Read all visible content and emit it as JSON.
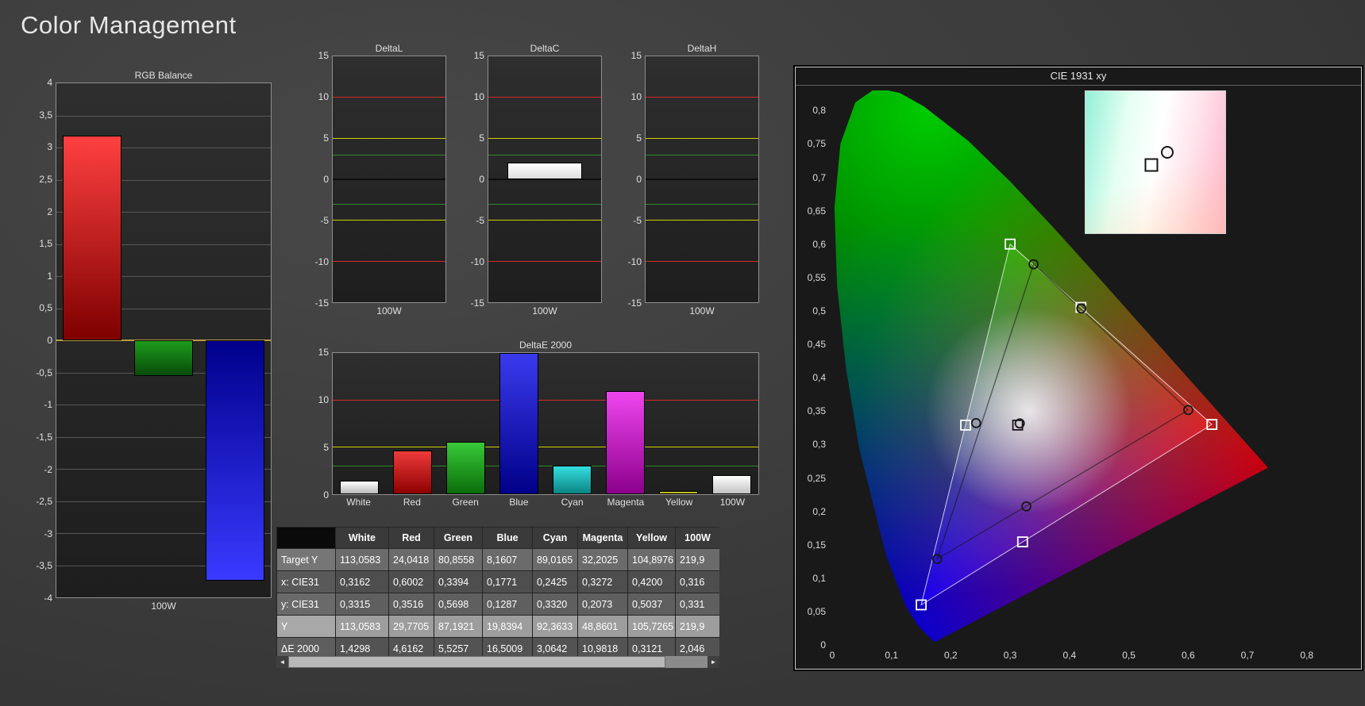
{
  "page": {
    "title": "Color Management"
  },
  "table": {
    "columns": [
      "",
      "White",
      "Red",
      "Green",
      "Blue",
      "Cyan",
      "Magenta",
      "Yellow",
      "100W"
    ],
    "rows": [
      {
        "label": "Target Y",
        "selected": false,
        "values": [
          "113,0583",
          "24,0418",
          "80,8558",
          "8,1607",
          "89,0165",
          "32,2025",
          "104,8976",
          "219,9"
        ]
      },
      {
        "label": "x: CIE31",
        "selected": false,
        "values": [
          "0,3162",
          "0,6002",
          "0,3394",
          "0,1771",
          "0,2425",
          "0,3272",
          "0,4200",
          "0,316"
        ]
      },
      {
        "label": "y: CIE31",
        "selected": false,
        "values": [
          "0,3315",
          "0,3516",
          "0,5698",
          "0,1287",
          "0,3320",
          "0,2073",
          "0,5037",
          "0,331"
        ]
      },
      {
        "label": "Y",
        "selected": true,
        "values": [
          "113,0583",
          "29,7705",
          "87,1921",
          "19,8394",
          "92,3633",
          "48,8601",
          "105,7265",
          "219,9"
        ]
      },
      {
        "label": "ΔE 2000",
        "selected": false,
        "values": [
          "1,4298",
          "4,6162",
          "5,5257",
          "16,5009",
          "3,0642",
          "10,9818",
          "0,3121",
          "2,046"
        ]
      }
    ],
    "scrollbar": {
      "left_arrow": "◄",
      "right_arrow": "►"
    }
  },
  "chart_data": [
    {
      "id": "rgb-balance",
      "type": "bar",
      "title": "RGB Balance",
      "xlabel": "100W",
      "categories": [
        "Red",
        "Green",
        "Blue"
      ],
      "values": [
        3.18,
        -0.56,
        -3.74
      ],
      "bar_colors": [
        {
          "from": "#ff4040",
          "to": "#7e0000"
        },
        {
          "from": "#1c9c1c",
          "to": "#0a4a0a"
        },
        {
          "from": "#00008c",
          "to": "#3a3aff"
        }
      ],
      "ylim": [
        -4,
        4
      ],
      "ytick_step": 0.5,
      "grid": true,
      "ref_lines": [
        {
          "y": 0,
          "color": "#b99a45",
          "width": 2
        }
      ]
    },
    {
      "id": "delta-l",
      "type": "bar",
      "title": "DeltaL",
      "xlabel": "100W",
      "categories": [
        "100W"
      ],
      "values": [
        0
      ],
      "bar_colors": [
        {
          "from": "#ffffff",
          "to": "#d8d8d8"
        }
      ],
      "ylim": [
        -15,
        15
      ],
      "yticks": [
        15,
        10,
        5,
        0,
        -5,
        -10,
        -15
      ],
      "ref_lines": [
        {
          "y": 10,
          "color": "#d42a2a"
        },
        {
          "y": -10,
          "color": "#d42a2a"
        },
        {
          "y": 5,
          "color": "#cfcf00"
        },
        {
          "y": -5,
          "color": "#cfcf00"
        },
        {
          "y": 3,
          "color": "#2d8b2d"
        },
        {
          "y": -3,
          "color": "#2d8b2d"
        },
        {
          "y": 0,
          "color": "#0d0d0d",
          "width": 2
        }
      ]
    },
    {
      "id": "delta-c",
      "type": "bar",
      "title": "DeltaC",
      "xlabel": "100W",
      "categories": [
        "100W"
      ],
      "values": [
        2.05
      ],
      "bar_colors": [
        {
          "from": "#ffffff",
          "to": "#dedede"
        }
      ],
      "ylim": [
        -15,
        15
      ],
      "yticks": [
        15,
        10,
        5,
        0,
        -5,
        -10,
        -15
      ],
      "ref_lines": [
        {
          "y": 10,
          "color": "#d42a2a"
        },
        {
          "y": -10,
          "color": "#d42a2a"
        },
        {
          "y": 5,
          "color": "#cfcf00"
        },
        {
          "y": -5,
          "color": "#cfcf00"
        },
        {
          "y": 3,
          "color": "#2d8b2d"
        },
        {
          "y": -3,
          "color": "#2d8b2d"
        },
        {
          "y": 0,
          "color": "#0d0d0d",
          "width": 2
        }
      ]
    },
    {
      "id": "delta-h",
      "type": "bar",
      "title": "DeltaH",
      "xlabel": "100W",
      "categories": [
        "100W"
      ],
      "values": [
        0
      ],
      "bar_colors": [
        {
          "from": "#ffffff",
          "to": "#d8d8d8"
        }
      ],
      "ylim": [
        -15,
        15
      ],
      "yticks": [
        15,
        10,
        5,
        0,
        -5,
        -10,
        -15
      ],
      "ref_lines": [
        {
          "y": 10,
          "color": "#d42a2a"
        },
        {
          "y": -10,
          "color": "#d42a2a"
        },
        {
          "y": 5,
          "color": "#cfcf00"
        },
        {
          "y": -5,
          "color": "#cfcf00"
        },
        {
          "y": 3,
          "color": "#2d8b2d"
        },
        {
          "y": -3,
          "color": "#2d8b2d"
        },
        {
          "y": 0,
          "color": "#0d0d0d",
          "width": 2
        }
      ]
    },
    {
      "id": "delta-e-2000",
      "type": "bar",
      "title": "DeltaE 2000",
      "xlabel": "",
      "categories": [
        "White",
        "Red",
        "Green",
        "Blue",
        "Cyan",
        "Magenta",
        "Yellow",
        "100W"
      ],
      "values": [
        1.4298,
        4.6162,
        5.5257,
        16.5009,
        3.0642,
        10.9818,
        0.3121,
        2.046
      ],
      "bar_colors": [
        {
          "from": "#ffffff",
          "to": "#b9b9b9"
        },
        {
          "from": "#ee3a3a",
          "to": "#8e0000"
        },
        {
          "from": "#39c939",
          "to": "#0b6e0b"
        },
        {
          "from": "#3a3aee",
          "to": "#000088"
        },
        {
          "from": "#35dede",
          "to": "#0b8484"
        },
        {
          "from": "#ee46ee",
          "to": "#8c008c"
        },
        {
          "from": "#e8e83a",
          "to": "#8c8c00"
        },
        {
          "from": "#ffffff",
          "to": "#c2c2c2"
        }
      ],
      "ylim": [
        0,
        15
      ],
      "yticks": [
        15,
        10,
        5,
        0
      ],
      "ref_lines": [
        {
          "y": 10,
          "color": "#d42a2a"
        },
        {
          "y": 5,
          "color": "#cfcf00"
        },
        {
          "y": 3,
          "color": "#2d8b2d"
        }
      ],
      "show_categories": true
    },
    {
      "id": "cie-1931",
      "type": "scatter",
      "title": "CIE 1931 xy",
      "xlim": [
        0,
        0.87
      ],
      "ylim": [
        0,
        0.83
      ],
      "xticks": [
        0,
        0.1,
        0.2,
        0.3,
        0.4,
        0.5,
        0.6,
        0.7,
        0.8
      ],
      "yticks": [
        0.8,
        0.75,
        0.7,
        0.65,
        0.6,
        0.55,
        0.5,
        0.45,
        0.4,
        0.35,
        0.3,
        0.25,
        0.2,
        0.15,
        0.1,
        0.05,
        0
      ],
      "locus": [
        [
          0.1741,
          0.005
        ],
        [
          0.1738,
          0.0049
        ],
        [
          0.173,
          0.0048
        ],
        [
          0.1714,
          0.0051
        ],
        [
          0.1689,
          0.0069
        ],
        [
          0.1644,
          0.0109
        ],
        [
          0.1566,
          0.0177
        ],
        [
          0.144,
          0.0297
        ],
        [
          0.1241,
          0.0578
        ],
        [
          0.0913,
          0.1327
        ],
        [
          0.0454,
          0.295
        ],
        [
          0.0235,
          0.4127
        ],
        [
          0.0082,
          0.5384
        ],
        [
          0.0039,
          0.6548
        ],
        [
          0.0139,
          0.7502
        ],
        [
          0.0389,
          0.812
        ],
        [
          0.0743,
          0.8338
        ],
        [
          0.1142,
          0.8262
        ],
        [
          0.1547,
          0.8059
        ],
        [
          0.2296,
          0.7543
        ],
        [
          0.3016,
          0.6923
        ],
        [
          0.3731,
          0.6245
        ],
        [
          0.4441,
          0.5547
        ],
        [
          0.5125,
          0.4866
        ],
        [
          0.5752,
          0.4242
        ],
        [
          0.627,
          0.3725
        ],
        [
          0.6658,
          0.334
        ],
        [
          0.6915,
          0.3083
        ],
        [
          0.7079,
          0.292
        ],
        [
          0.719,
          0.2809
        ],
        [
          0.7347,
          0.2653
        ]
      ],
      "target_gamut": {
        "red": [
          0.64,
          0.33
        ],
        "green": [
          0.3,
          0.6
        ],
        "blue": [
          0.15,
          0.06
        ]
      },
      "targets": [
        {
          "name": "white",
          "xy": [
            0.3127,
            0.329
          ]
        },
        {
          "name": "red",
          "xy": [
            0.64,
            0.33
          ]
        },
        {
          "name": "green",
          "xy": [
            0.3,
            0.6
          ]
        },
        {
          "name": "blue",
          "xy": [
            0.15,
            0.06
          ]
        },
        {
          "name": "cyan",
          "xy": [
            0.225,
            0.329
          ]
        },
        {
          "name": "magenta",
          "xy": [
            0.3209,
            0.1542
          ]
        },
        {
          "name": "yellow",
          "xy": [
            0.4193,
            0.5053
          ]
        }
      ],
      "measured": [
        {
          "name": "white",
          "xy": [
            0.3162,
            0.3315
          ]
        },
        {
          "name": "red",
          "xy": [
            0.6002,
            0.3516
          ]
        },
        {
          "name": "green",
          "xy": [
            0.3394,
            0.5698
          ]
        },
        {
          "name": "blue",
          "xy": [
            0.1771,
            0.1287
          ]
        },
        {
          "name": "cyan",
          "xy": [
            0.2425,
            0.332
          ]
        },
        {
          "name": "magenta",
          "xy": [
            0.3272,
            0.2073
          ]
        },
        {
          "name": "yellow",
          "xy": [
            0.42,
            0.5037
          ]
        }
      ],
      "inset": {
        "square_pos": [
          0.47,
          0.52
        ],
        "circle_pos": [
          0.585,
          0.43
        ]
      }
    }
  ]
}
